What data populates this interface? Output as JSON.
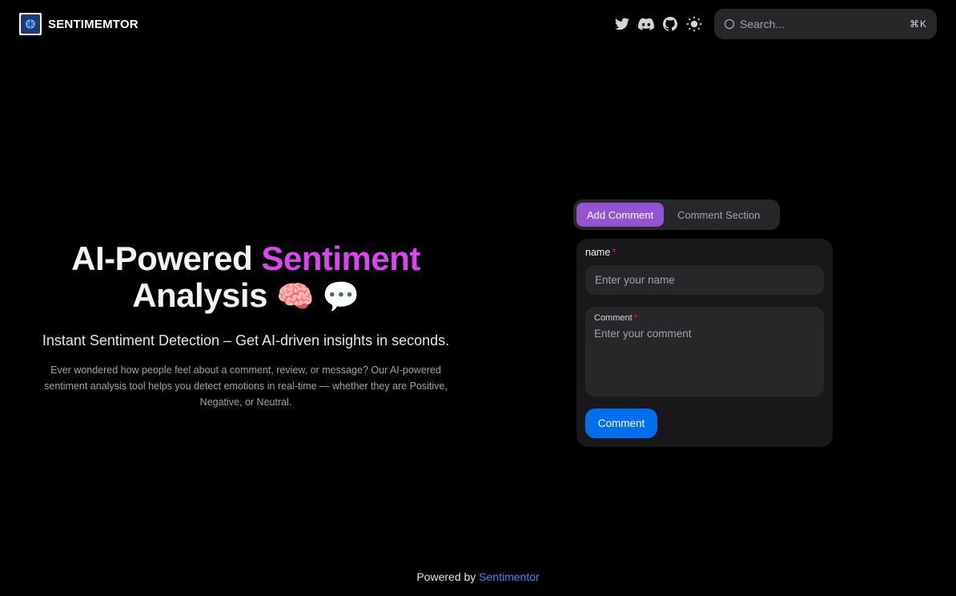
{
  "navbar": {
    "brand": "SENTIMEMTOR",
    "icons": [
      "twitter-icon",
      "discord-icon",
      "github-icon",
      "sun-icon"
    ],
    "search": {
      "placeholder": "Search...",
      "shortcut": "⌘K"
    }
  },
  "hero": {
    "title_part1": "AI-Powered ",
    "title_accent": "Sentiment",
    "title_part2": "Analysis",
    "title_emojis": "🧠 💬",
    "subtitle": "Instant Sentiment Detection – Get AI-driven insights in seconds.",
    "description": "Ever wondered how people feel about a comment, review, or message? Our AI-powered sentiment analysis tool helps you detect emotions in real-time — whether they are Positive, Negative, or Neutral."
  },
  "tabs": [
    {
      "label": "Add Comment",
      "active": true
    },
    {
      "label": "Comment Section",
      "active": false
    }
  ],
  "form": {
    "name_label": "name",
    "required_mark": "*",
    "name_placeholder": "Enter your name",
    "comment_label": "Comment",
    "comment_placeholder": "Enter your comment",
    "submit_label": "Comment"
  },
  "footer": {
    "prefix": "Powered by",
    "link": "Sentimentor"
  },
  "colors": {
    "accent": "#d946ef",
    "tab_active": "#9353d3",
    "primary_button": "#006fee",
    "link": "#338ef7"
  }
}
